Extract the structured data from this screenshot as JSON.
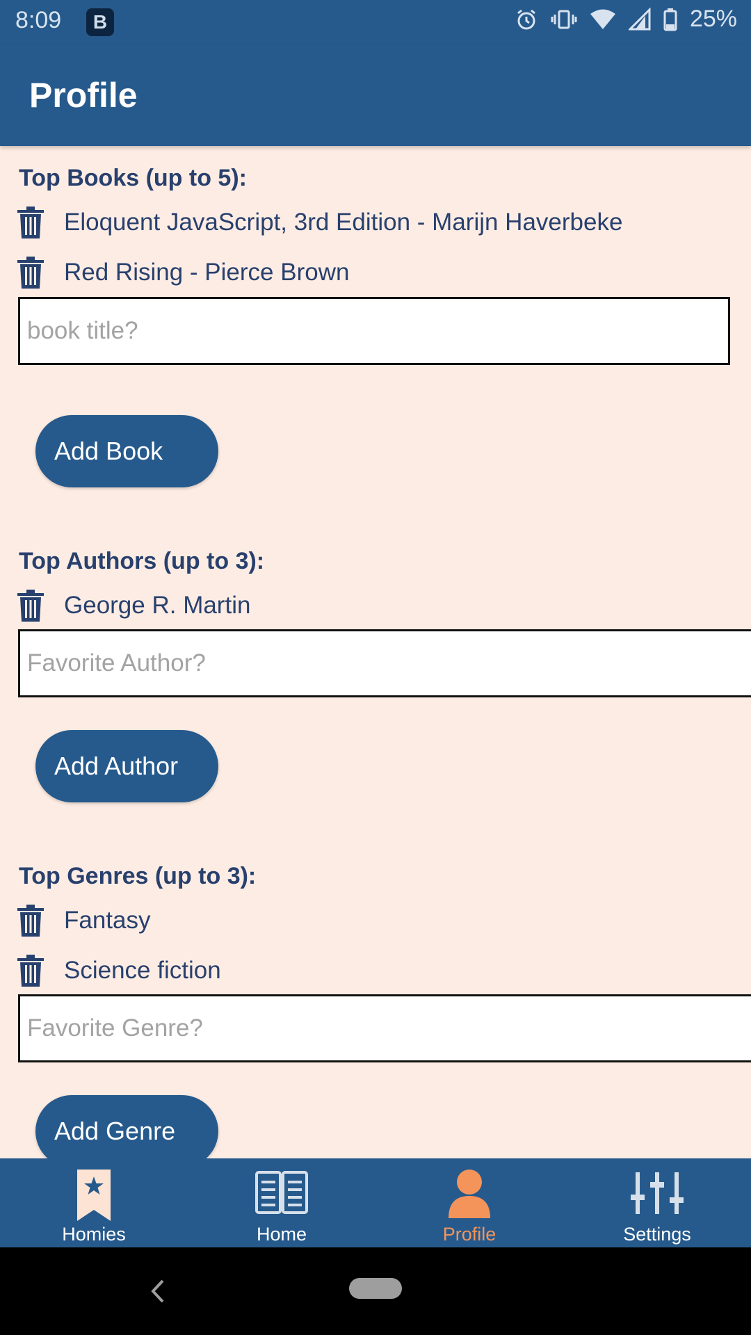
{
  "status_bar": {
    "time": "8:09",
    "app_badge": "B",
    "battery": "25%",
    "icons": [
      "alarm-icon",
      "vibrate-icon",
      "wifi-icon",
      "signal-icon",
      "battery-icon"
    ]
  },
  "app_bar": {
    "title": "Profile"
  },
  "books": {
    "heading": "Top Books (up to 5):",
    "items": [
      "Eloquent JavaScript, 3rd Edition - Marijn Haverbeke",
      "Red Rising - Pierce Brown"
    ],
    "input_placeholder": "book title?",
    "button_label": "Add Book"
  },
  "authors": {
    "heading": "Top Authors (up to 3):",
    "items": [
      "George R. Martin"
    ],
    "input_placeholder": "Favorite Author?",
    "button_label": "Add Author"
  },
  "genres": {
    "heading": "Top Genres (up to 3):",
    "items": [
      "Fantasy",
      "Science fiction"
    ],
    "input_placeholder": "Favorite Genre?",
    "button_label": "Add Genre"
  },
  "bottom_nav": {
    "items": [
      {
        "label": "Homies",
        "icon": "bookmark-star-icon"
      },
      {
        "label": "Home",
        "icon": "open-book-icon"
      },
      {
        "label": "Profile",
        "icon": "person-icon"
      },
      {
        "label": "Settings",
        "icon": "sliders-icon"
      }
    ],
    "active_index": 2
  },
  "colors": {
    "primary": "#265a8c",
    "background": "#fdece3",
    "text": "#28406e",
    "active_accent": "#f5945a"
  }
}
